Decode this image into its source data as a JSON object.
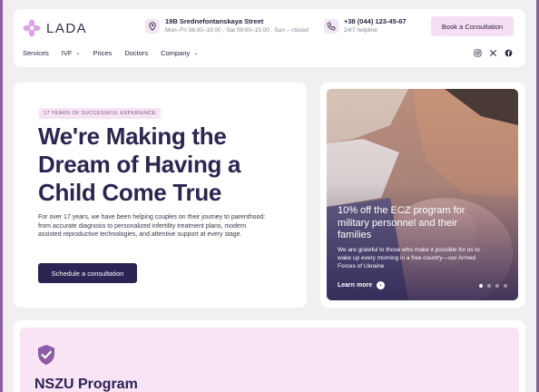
{
  "brand": {
    "name": "LADA",
    "accent": "#d9a5e3",
    "primary": "#2d2453",
    "pink": "#f7e3f5"
  },
  "header": {
    "address": {
      "title": "19B Srednefontanskaya Street",
      "sub": "Mon–Fri 08:00–19:00 , Sat 09:00–15:00 , Sun – closed",
      "icon": "location-pin-icon"
    },
    "phone": {
      "title": "+38 (044) 123-45-67",
      "sub": "24/7 helpline",
      "icon": "phone-icon"
    },
    "cta": "Book a Consultation"
  },
  "nav": {
    "items": [
      {
        "label": "Services",
        "dropdown": false
      },
      {
        "label": "IVF",
        "dropdown": true
      },
      {
        "label": "Prices",
        "dropdown": false
      },
      {
        "label": "Doctors",
        "dropdown": false
      },
      {
        "label": "Company",
        "dropdown": true
      }
    ],
    "chevron": "⌄",
    "socials": [
      "instagram-icon",
      "x-icon",
      "facebook-icon"
    ]
  },
  "hero": {
    "badge": "17 YEARS OF SUCCESSFUL EXPERIENCE",
    "title": "We're Making the Dream of Having a Child Come True",
    "text": "For over 17 years, we have been helping couples on their journey to parenthood: from accurate diagnosis to personalized infertility treatment plans, modern assisted reproductive technologies, and attentive support at every stage.",
    "button": "Schedule a consultation"
  },
  "promo": {
    "title": "10% off the ECZ program for military personnel and their families",
    "text": "We are grateful to those who make it possible for us to wake up every morning in a free country—our Armed Forces of Ukraine",
    "link": "Learn more",
    "arrow": "›",
    "slides_total": 4,
    "slide_active": 1
  },
  "nszu": {
    "title": "NSZU Program",
    "icon": "shield-check-icon"
  }
}
